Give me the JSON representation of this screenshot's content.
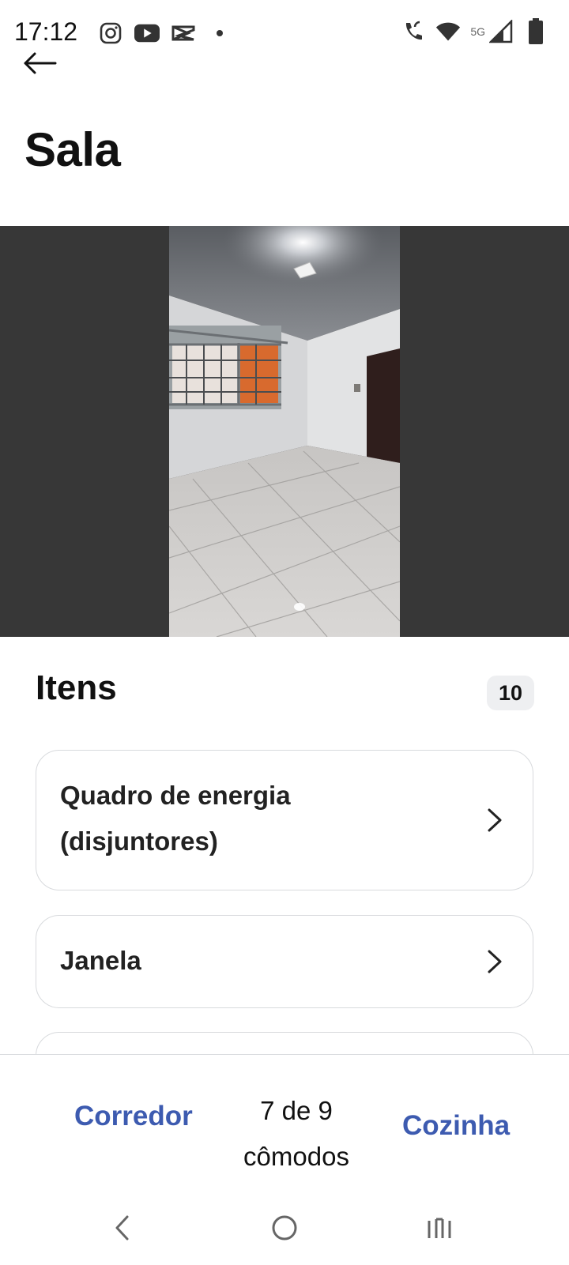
{
  "status_bar": {
    "time": "17:12",
    "network_label": "5G",
    "left_icons": [
      "instagram-icon",
      "youtube-icon",
      "capcut-icon",
      "notification-dot-icon"
    ],
    "right_icons": [
      "wifi-calling-icon",
      "wifi-icon",
      "signal-icon",
      "battery-icon"
    ]
  },
  "header": {
    "back_icon": "arrow-left-icon",
    "title": "Sala"
  },
  "photo": {
    "description_icon": "room-photo"
  },
  "items": {
    "heading": "Itens",
    "count": "10",
    "list": [
      {
        "label_line1": "Quadro de energia",
        "label_line2": "(disjuntores)"
      },
      {
        "label": "Janela"
      }
    ]
  },
  "bottom_nav": {
    "prev_label": "Corredor",
    "progress_line1": "7 de 9",
    "progress_line2": "cômodos",
    "next_label": "Cozinha",
    "accent_color": "#3d5bb0"
  },
  "system_nav": {
    "icons": [
      "back-nav-icon",
      "home-nav-icon",
      "recents-nav-icon"
    ]
  }
}
